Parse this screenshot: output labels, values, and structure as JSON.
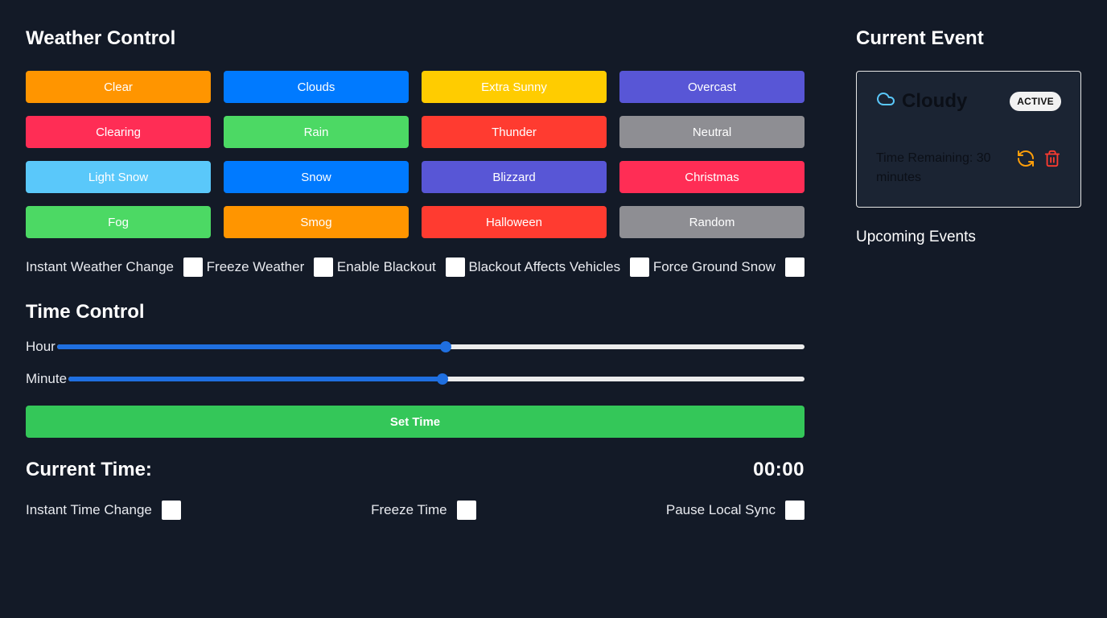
{
  "weather": {
    "title": "Weather Control",
    "buttons": [
      {
        "label": "Clear",
        "color": "#ff9500"
      },
      {
        "label": "Clouds",
        "color": "#007aff"
      },
      {
        "label": "Extra Sunny",
        "color": "#ffcc00"
      },
      {
        "label": "Overcast",
        "color": "#5856d6"
      },
      {
        "label": "Clearing",
        "color": "#ff2d55"
      },
      {
        "label": "Rain",
        "color": "#4cd964"
      },
      {
        "label": "Thunder",
        "color": "#ff3b30"
      },
      {
        "label": "Neutral",
        "color": "#8e8e93"
      },
      {
        "label": "Light Snow",
        "color": "#5ac8fa"
      },
      {
        "label": "Snow",
        "color": "#007aff"
      },
      {
        "label": "Blizzard",
        "color": "#5856d6"
      },
      {
        "label": "Christmas",
        "color": "#ff2d55"
      },
      {
        "label": "Fog",
        "color": "#4cd964"
      },
      {
        "label": "Smog",
        "color": "#ff9500"
      },
      {
        "label": "Halloween",
        "color": "#ff3b30"
      },
      {
        "label": "Random",
        "color": "#8e8e93"
      }
    ],
    "toggles": [
      {
        "label": "Instant Weather Change",
        "checked": false
      },
      {
        "label": "Freeze Weather",
        "checked": false
      },
      {
        "label": "Enable Blackout",
        "checked": false
      },
      {
        "label": "Blackout Affects Vehicles",
        "checked": false
      },
      {
        "label": "Force Ground Snow",
        "checked": false
      }
    ]
  },
  "time": {
    "title": "Time Control",
    "hour_label": "Hour",
    "hour_value_fraction": 0.52,
    "minute_label": "Minute",
    "minute_value_fraction": 0.508,
    "set_time_label": "Set Time",
    "current_time_label": "Current Time:",
    "current_time_value": "00:00",
    "toggles": [
      {
        "label": "Instant Time Change",
        "checked": false
      },
      {
        "label": "Freeze Time",
        "checked": false
      },
      {
        "label": "Pause Local Sync",
        "checked": false
      }
    ]
  },
  "event": {
    "title": "Current Event",
    "icon": "cloud-icon",
    "name": "Cloudy",
    "badge": "ACTIVE",
    "remaining": "Time Remaining: 30 minutes",
    "actions": [
      "refresh-icon",
      "trash-icon"
    ],
    "upcoming_label": "Upcoming Events"
  },
  "colors": {
    "background": "#131a27",
    "card": "#1b2433",
    "accent_blue": "#1f6fe0",
    "set_time_green": "#34c759",
    "refresh_orange": "#ff9f0a",
    "delete_red": "#ff3b30",
    "cloud_icon": "#5ac8fa"
  }
}
